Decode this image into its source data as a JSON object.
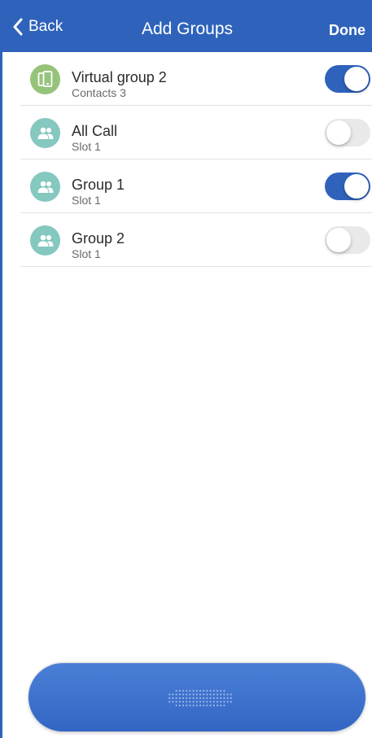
{
  "header": {
    "back_label": "Back",
    "title": "Add Groups",
    "done_label": "Done"
  },
  "groups": [
    {
      "name": "Virtual group 2",
      "subtitle": "Contacts 3",
      "icon": "phone-icon",
      "icon_color": "#96c37a",
      "enabled": true
    },
    {
      "name": "All Call",
      "subtitle": "Slot 1",
      "icon": "group-icon",
      "icon_color": "#84c8bf",
      "enabled": false
    },
    {
      "name": "Group 1",
      "subtitle": "Slot 1",
      "icon": "group-icon",
      "icon_color": "#84c8bf",
      "enabled": true
    },
    {
      "name": "Group 2",
      "subtitle": "Slot 1",
      "icon": "group-icon",
      "icon_color": "#84c8bf",
      "enabled": false
    }
  ],
  "colors": {
    "accent": "#2f63bb",
    "toggle_off": "#e9e9ea"
  },
  "ptt_button": {
    "icon": "speaker-grille-icon"
  }
}
